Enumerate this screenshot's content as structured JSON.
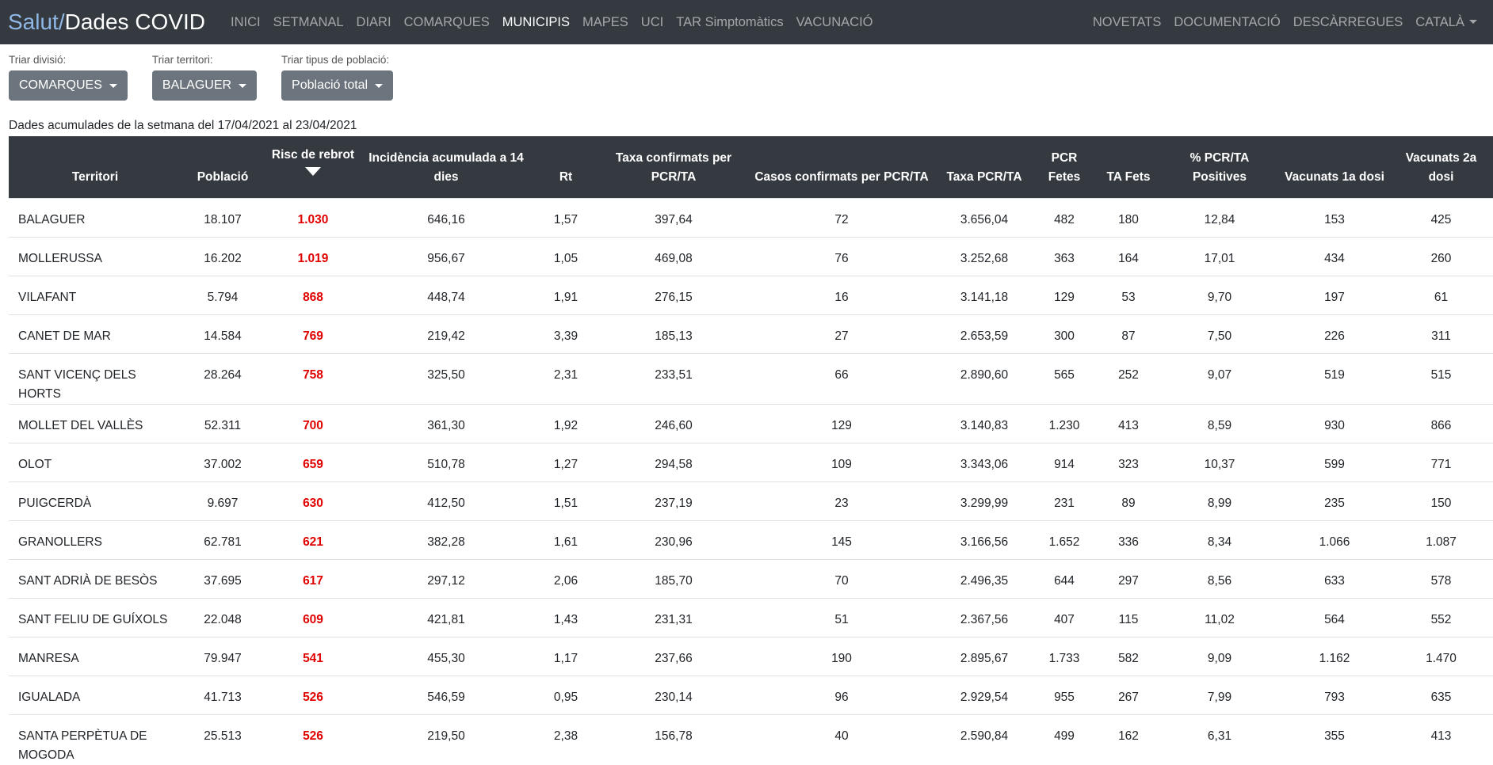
{
  "navbar": {
    "brand_part1": "Salut/",
    "brand_part2": "Dades COVID",
    "left_links": [
      {
        "label": "INICI"
      },
      {
        "label": "SETMANAL"
      },
      {
        "label": "DIARI"
      },
      {
        "label": "COMARQUES"
      },
      {
        "label": "MUNICIPIS",
        "active": true
      },
      {
        "label": "MAPES"
      },
      {
        "label": "UCI"
      },
      {
        "label": "TAR Simptomàtics"
      },
      {
        "label": "VACUNACIÓ"
      }
    ],
    "right_links": [
      {
        "label": "NOVETATS"
      },
      {
        "label": "DOCUMENTACIÓ"
      },
      {
        "label": "DESCÀRREGUES"
      },
      {
        "label": "CATALÀ"
      }
    ]
  },
  "filters": {
    "division": {
      "label": "Triar divisió:",
      "value": "COMARQUES"
    },
    "territory": {
      "label": "Triar territori:",
      "value": "BALAGUER"
    },
    "population": {
      "label": "Triar tipus de població:",
      "value": "Població total"
    }
  },
  "period_text": "Dades acumulades de la setmana del 17/04/2021 al 23/04/2021",
  "table": {
    "headers": {
      "territori": "Territori",
      "poblacio": "Població",
      "risc": "Risc de rebrot",
      "ia14": "Incidència acumulada a 14 dies",
      "rt": "Rt",
      "taxa_conf": "Taxa confirmats per PCR/TA",
      "casos_conf": "Casos confirmats per PCR/TA",
      "taxa_pcr": "Taxa PCR/TA",
      "pcr": "PCR Fetes",
      "ta": "TA Fets",
      "pct_pos": "% PCR/TA Positives",
      "vac1": "Vacunats 1a dosi",
      "vac2": "Vacunats 2a dosi"
    },
    "rows": [
      [
        "BALAGUER",
        "18.107",
        "1.030",
        "646,16",
        "1,57",
        "397,64",
        "72",
        "3.656,04",
        "482",
        "180",
        "12,84",
        "153",
        "425"
      ],
      [
        "MOLLERUSSA",
        "16.202",
        "1.019",
        "956,67",
        "1,05",
        "469,08",
        "76",
        "3.252,68",
        "363",
        "164",
        "17,01",
        "434",
        "260"
      ],
      [
        "VILAFANT",
        "5.794",
        "868",
        "448,74",
        "1,91",
        "276,15",
        "16",
        "3.141,18",
        "129",
        "53",
        "9,70",
        "197",
        "61"
      ],
      [
        "CANET DE MAR",
        "14.584",
        "769",
        "219,42",
        "3,39",
        "185,13",
        "27",
        "2.653,59",
        "300",
        "87",
        "7,50",
        "226",
        "311"
      ],
      [
        "SANT VICENÇ DELS HORTS",
        "28.264",
        "758",
        "325,50",
        "2,31",
        "233,51",
        "66",
        "2.890,60",
        "565",
        "252",
        "9,07",
        "519",
        "515"
      ],
      [
        "MOLLET DEL VALLÈS",
        "52.311",
        "700",
        "361,30",
        "1,92",
        "246,60",
        "129",
        "3.140,83",
        "1.230",
        "413",
        "8,59",
        "930",
        "866"
      ],
      [
        "OLOT",
        "37.002",
        "659",
        "510,78",
        "1,27",
        "294,58",
        "109",
        "3.343,06",
        "914",
        "323",
        "10,37",
        "599",
        "771"
      ],
      [
        "PUIGCERDÀ",
        "9.697",
        "630",
        "412,50",
        "1,51",
        "237,19",
        "23",
        "3.299,99",
        "231",
        "89",
        "8,99",
        "235",
        "150"
      ],
      [
        "GRANOLLERS",
        "62.781",
        "621",
        "382,28",
        "1,61",
        "230,96",
        "145",
        "3.166,56",
        "1.652",
        "336",
        "8,34",
        "1.066",
        "1.087"
      ],
      [
        "SANT ADRIÀ DE BESÒS",
        "37.695",
        "617",
        "297,12",
        "2,06",
        "185,70",
        "70",
        "2.496,35",
        "644",
        "297",
        "8,56",
        "633",
        "578"
      ],
      [
        "SANT FELIU DE GUÍXOLS",
        "22.048",
        "609",
        "421,81",
        "1,43",
        "231,31",
        "51",
        "2.367,56",
        "407",
        "115",
        "11,02",
        "564",
        "552"
      ],
      [
        "MANRESA",
        "79.947",
        "541",
        "455,30",
        "1,17",
        "237,66",
        "190",
        "2.895,67",
        "1.733",
        "582",
        "9,09",
        "1.162",
        "1.470"
      ],
      [
        "IGUALADA",
        "41.713",
        "526",
        "546,59",
        "0,95",
        "230,14",
        "96",
        "2.929,54",
        "955",
        "267",
        "7,99",
        "793",
        "635"
      ],
      [
        "SANTA PERPÈTUA DE MOGODA",
        "25.513",
        "526",
        "219,50",
        "2,38",
        "156,78",
        "40",
        "2.590,84",
        "499",
        "162",
        "6,31",
        "355",
        "413"
      ]
    ]
  },
  "colors": {
    "navbar_bg": "#343a40",
    "brand_accent": "#8fb8e6",
    "risk_text": "#e00000",
    "button_bg": "#6c757d"
  }
}
